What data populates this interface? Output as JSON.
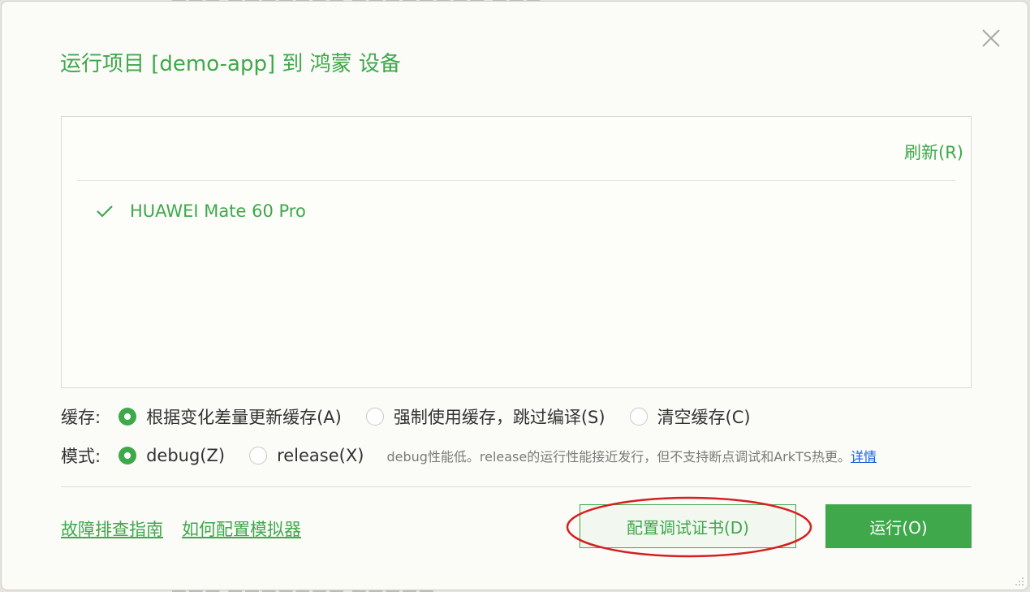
{
  "dialog": {
    "title": "运行项目 [demo-app] 到 鸿蒙 设备",
    "close_icon": "close-icon"
  },
  "devices": {
    "refresh_label": "刷新(R)",
    "items": [
      {
        "name": "HUAWEI Mate 60 Pro",
        "selected": true
      }
    ]
  },
  "cache": {
    "label": "缓存:",
    "options": [
      {
        "label": "根据变化差量更新缓存(A)",
        "checked": true
      },
      {
        "label": "强制使用缓存，跳过编译(S)",
        "checked": false
      },
      {
        "label": "清空缓存(C)",
        "checked": false
      }
    ]
  },
  "mode": {
    "label": "模式:",
    "options": [
      {
        "label": "debug(Z)",
        "checked": true
      },
      {
        "label": "release(X)",
        "checked": false
      }
    ],
    "note": "debug性能低。release的运行性能接近发行，但不支持断点调试和ArkTS热更。",
    "detail_link": "详情"
  },
  "footer": {
    "troubleshoot_link": "故障排查指南",
    "emulator_link": "如何配置模拟器",
    "cert_button": "配置调试证书(D)",
    "run_button": "运行(O)"
  },
  "colors": {
    "accent": "#3ea84b",
    "link_blue": "#1a5fd6",
    "highlight_ellipse": "#d42020"
  }
}
